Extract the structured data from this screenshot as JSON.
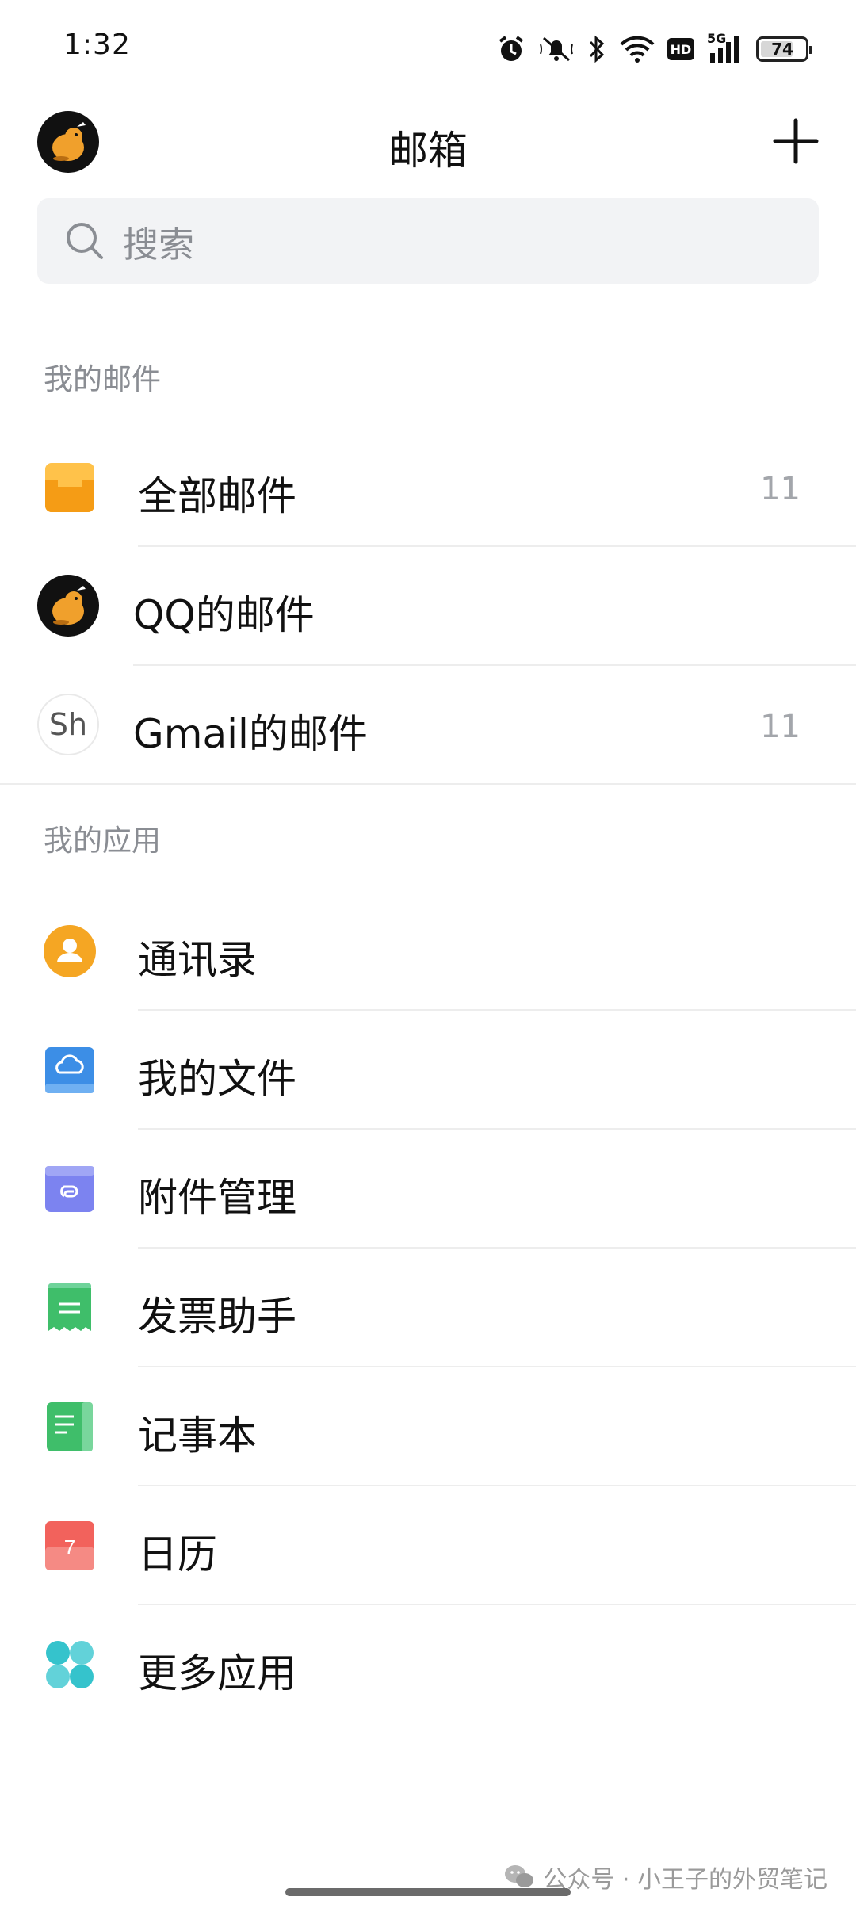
{
  "status_bar": {
    "time": "1:32",
    "network": "5G",
    "hd": "HD",
    "battery_level": "74",
    "battery_fraction": 0.74
  },
  "header": {
    "title": "邮箱",
    "avatar_icon": "mascot-avatar-icon",
    "add_icon": "plus-icon"
  },
  "search": {
    "placeholder": "搜索",
    "icon": "search-icon"
  },
  "my_mail": {
    "section_title": "我的邮件",
    "items": [
      {
        "label": "全部邮件",
        "count": "11",
        "icon": "inbox-tray-icon"
      },
      {
        "label": "QQ的邮件",
        "count": "",
        "icon": "mascot-avatar-icon"
      },
      {
        "label": "Gmail的邮件",
        "count": "11",
        "icon_text": "Sh"
      }
    ]
  },
  "my_apps": {
    "section_title": "我的应用",
    "items": [
      {
        "label": "通讯录",
        "icon": "contacts-icon",
        "color": "#f5a623"
      },
      {
        "label": "我的文件",
        "icon": "cloud-files-icon",
        "color": "#3c8ee6"
      },
      {
        "label": "附件管理",
        "icon": "attachment-icon",
        "color": "#7c83f0"
      },
      {
        "label": "发票助手",
        "icon": "invoice-icon",
        "color": "#3fbe6a"
      },
      {
        "label": "记事本",
        "icon": "notepad-icon",
        "color": "#3fbe6a"
      },
      {
        "label": "日历",
        "icon": "calendar-icon",
        "calendar_day": "7",
        "color": "#f2625c"
      },
      {
        "label": "更多应用",
        "icon": "more-apps-icon",
        "color": "#35c3cc"
      }
    ]
  },
  "footer": {
    "watermark": "公众号 · 小王子的外贸笔记",
    "watermark_icon": "wechat-icon"
  }
}
